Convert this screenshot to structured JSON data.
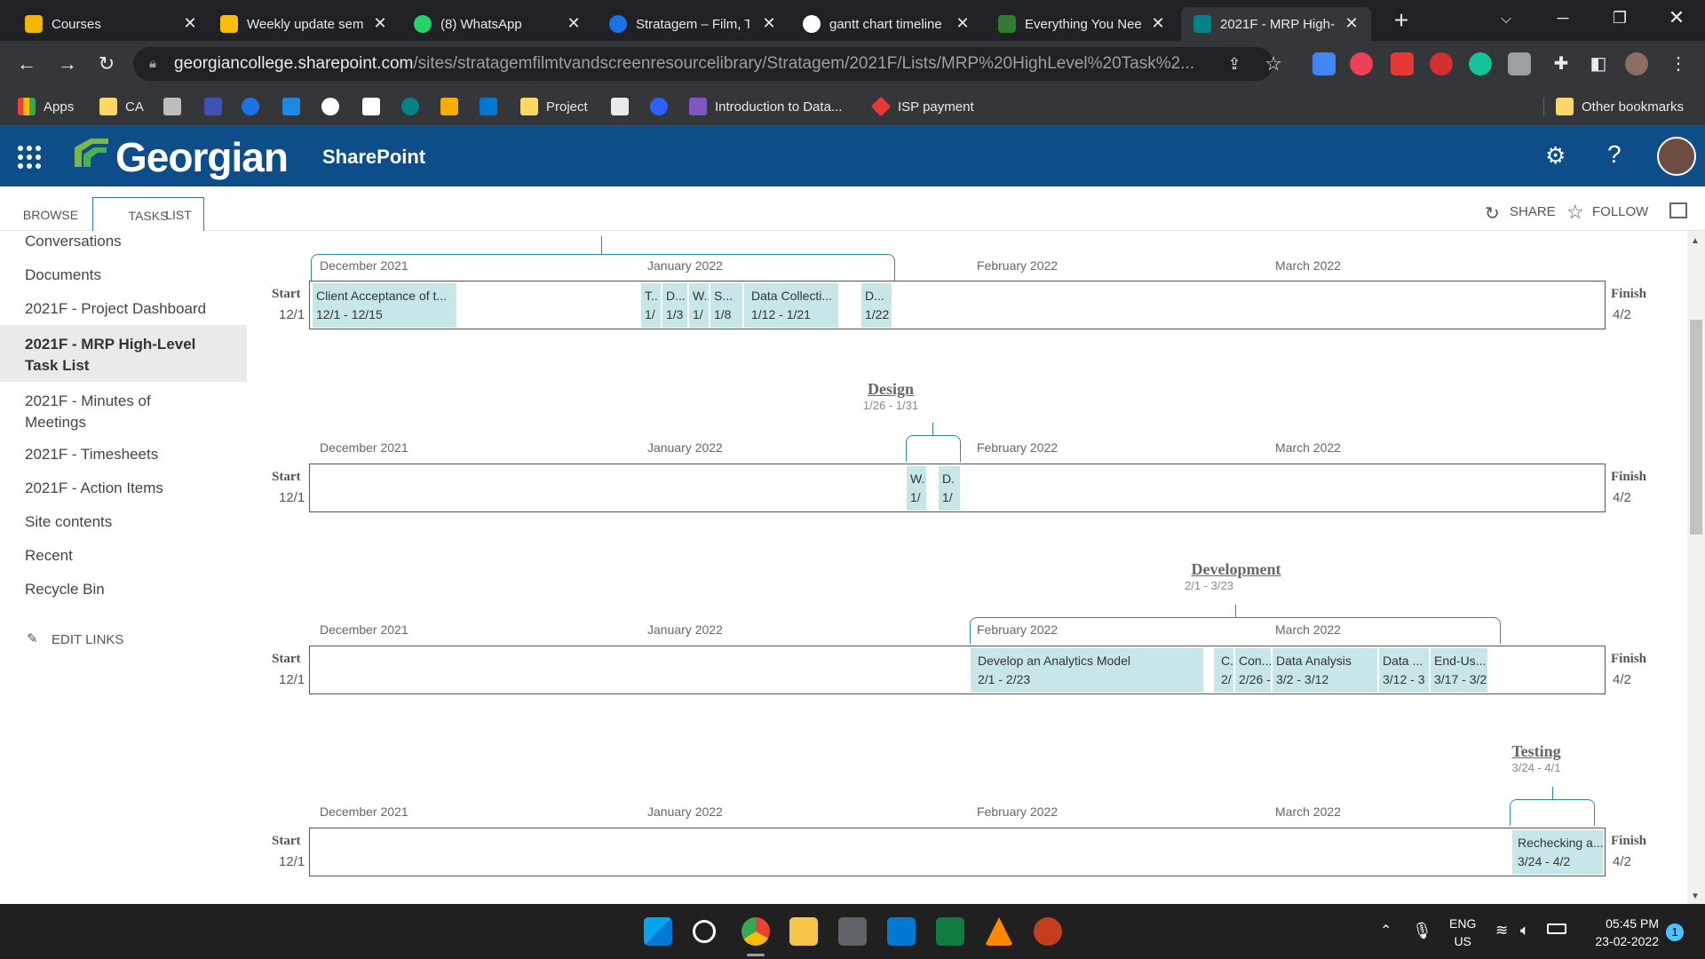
{
  "browser": {
    "tabs": [
      {
        "title": "Courses",
        "color": "#f4b400"
      },
      {
        "title": "Weekly update sem",
        "color": "#fbbc04"
      },
      {
        "title": "(8) WhatsApp",
        "color": "#25d366"
      },
      {
        "title": "Stratagem – Film, T",
        "color": "#1a73e8"
      },
      {
        "title": "gantt chart timeline",
        "color": "#ffffff"
      },
      {
        "title": "Everything You Nee",
        "color": "#2e7d32"
      },
      {
        "title": "2021F - MRP High-",
        "color": "#038387"
      }
    ],
    "url_host": "georgiancollege.sharepoint.com",
    "url_path": "/sites/stratagemfilmtvandscreenresourcelibrary/Stratagem/2021F/Lists/MRP%20HighLevel%20Task%2...",
    "bookmarks": [
      {
        "label": "Apps",
        "icon": "apps-grid-icon"
      },
      {
        "label": "CA",
        "icon": "folder-icon"
      },
      {
        "label": "Project",
        "icon": "folder-icon"
      },
      {
        "label": "Introduction to Data...",
        "icon": "chart-icon"
      },
      {
        "label": "ISP payment",
        "icon": "diamond-icon"
      },
      {
        "label": "Other bookmarks",
        "icon": "folder-icon"
      }
    ]
  },
  "suite": {
    "brand": "Georgian",
    "app": "SharePoint"
  },
  "ribbon": {
    "tabs": [
      "BROWSE",
      "TASKS",
      "LIST"
    ],
    "share": "SHARE",
    "follow": "FOLLOW"
  },
  "nav": {
    "items": [
      "Conversations",
      "Documents",
      "2021F - Project Dashboard",
      "2021F - MRP High-Level Task List",
      "2021F - Minutes of Meetings",
      "2021F - Timesheets",
      "2021F - Action Items",
      "Site contents",
      "Recent",
      "Recycle Bin"
    ],
    "edit_links": "EDIT LINKS"
  },
  "timeline": {
    "months": [
      "December 2021",
      "January 2022",
      "February 2022",
      "March 2022"
    ],
    "start_label": "Start",
    "start_date": "12/1",
    "finish_label": "Finish",
    "finish_date": "4/2",
    "rows": [
      {
        "phase": "",
        "phase_dates": "",
        "tasks": [
          {
            "name": "Client Acceptance of t...",
            "dates": "12/1 - 12/15"
          },
          {
            "name": "T..",
            "dates": "1/"
          },
          {
            "name": "D...",
            "dates": "1/3"
          },
          {
            "name": "W..",
            "dates": "1/"
          },
          {
            "name": "S...",
            "dates": "1/8"
          },
          {
            "name": "Data Collecti...",
            "dates": "1/12 - 1/21"
          },
          {
            "name": "D...",
            "dates": "1/22"
          }
        ]
      },
      {
        "phase": "Design",
        "phase_dates": "1/26 - 1/31",
        "tasks": [
          {
            "name": "W.",
            "dates": "1/"
          },
          {
            "name": "D.",
            "dates": "1/"
          }
        ]
      },
      {
        "phase": "Development",
        "phase_dates": "2/1 - 3/23",
        "tasks": [
          {
            "name": "Develop an Analytics Model",
            "dates": "2/1 - 2/23"
          },
          {
            "name": "C..",
            "dates": "2/"
          },
          {
            "name": "Con...",
            "dates": "2/26 -"
          },
          {
            "name": "Data Analysis",
            "dates": "3/2 - 3/12"
          },
          {
            "name": "Data ...",
            "dates": "3/12 - 3"
          },
          {
            "name": "End-Us...",
            "dates": "3/17 - 3/2"
          }
        ]
      },
      {
        "phase": "Testing",
        "phase_dates": "3/24 - 4/1",
        "tasks": [
          {
            "name": "Rechecking a...",
            "dates": "3/24 - 4/2"
          }
        ]
      }
    ]
  },
  "taskbar": {
    "lang": "ENG",
    "region": "US",
    "time": "05:45 PM",
    "date": "23-02-2022",
    "notifications": "1"
  }
}
